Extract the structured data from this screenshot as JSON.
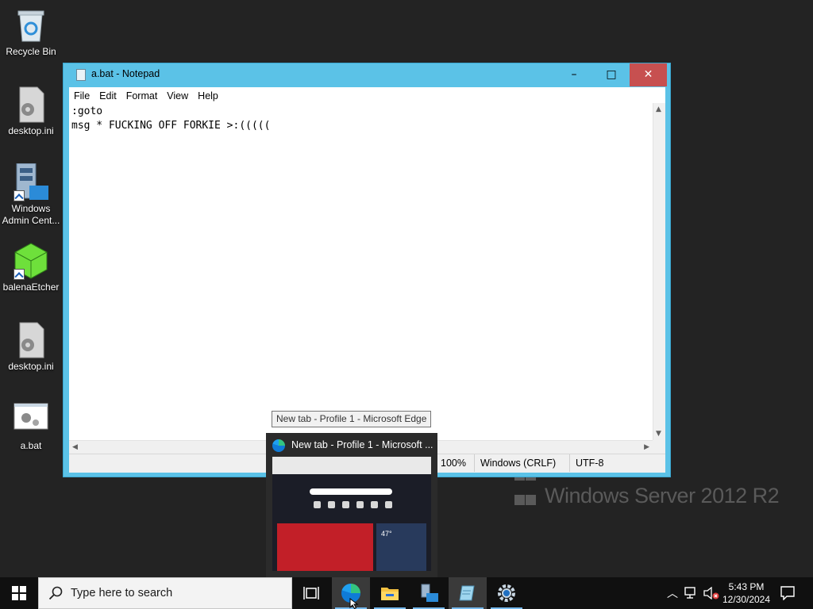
{
  "desktop": {
    "icons": [
      {
        "label": "Recycle Bin",
        "icon": "recycle-bin-icon"
      },
      {
        "label": "desktop.ini",
        "icon": "settings-file-icon"
      },
      {
        "label": "Windows Admin Cent...",
        "icon": "server-admin-icon"
      },
      {
        "label": "balenaEtcher",
        "icon": "cube-icon"
      },
      {
        "label": "desktop.ini",
        "icon": "settings-file-icon"
      },
      {
        "label": "a.bat",
        "icon": "batch-file-icon"
      }
    ],
    "watermark": "Windows Server 2012 R2"
  },
  "notepad": {
    "title": "a.bat - Notepad",
    "controls": {
      "minimize": "–",
      "maximize": "□",
      "close": "✕"
    },
    "menu": [
      "File",
      "Edit",
      "Format",
      "View",
      "Help"
    ],
    "content": ":goto\nmsg * FUCKING OFF FORKIE >:(((((",
    "status": {
      "zoom": "100%",
      "line_endings": "Windows (CRLF)",
      "encoding": "UTF-8"
    }
  },
  "tooltip": "New tab - Profile 1 - Microsoft Edge",
  "preview": {
    "title": "New tab - Profile 1 - Microsoft ...",
    "temperature": "47°"
  },
  "taskbar": {
    "search_placeholder": "Type here to search",
    "apps": [
      "task-view-icon",
      "edge-icon",
      "file-explorer-icon",
      "server-manager-icon",
      "notepad-icon",
      "settings-icon"
    ],
    "clock": {
      "time": "5:43 PM",
      "date": "12/30/2024"
    }
  },
  "colors": {
    "window_border": "#5bc2e7",
    "close_button": "#c75050",
    "taskbar": "#101010",
    "desktop": "#232323"
  }
}
